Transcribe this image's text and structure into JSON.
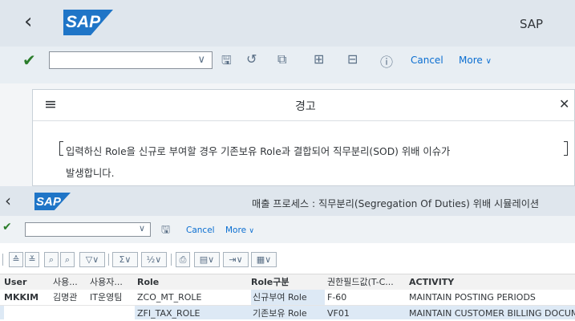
{
  "top_shell": {
    "title": "SAP",
    "logo_text": "SAP",
    "toolbar": {
      "cancel_label": "Cancel",
      "more_label": "More"
    }
  },
  "dialog": {
    "title": "경고",
    "message_line1": "입력하신 Role을 신규로 부여할 경우 기존보유 Role과 결합되어 직무분리(SOD) 위배 이슈가",
    "message_line2": "발생합니다."
  },
  "inner_shell": {
    "logo_text": "SAP",
    "title": "매출 프로세스 : 직무분리(Segregation Of Duties) 위배 시뮬레이션",
    "toolbar": {
      "cancel_label": "Cancel",
      "more_label": "More"
    }
  },
  "grid": {
    "columns": [
      "User",
      "사용...",
      "사용자...",
      "Role",
      "Role구분",
      "권한필드값(T-C...",
      "ACTIVITY"
    ],
    "rows": [
      [
        "MKKIM",
        "김명관",
        "IT운영팀",
        "ZCO_MT_ROLE",
        "신규부여 Role",
        "F-60",
        "MAINTAIN POSTING PERIODS"
      ],
      [
        "",
        "",
        "",
        "ZFI_TAX_ROLE",
        "기존보유 Role",
        "VF01",
        "MAINTAIN CUSTOMER BILLING DOCUMENT"
      ]
    ]
  },
  "icons": [
    "back-icon",
    "check-icon",
    "chevron-down-icon",
    "save-icon",
    "history-icon",
    "copy-icon",
    "expand-icon",
    "collapse-icon",
    "info-icon",
    "menu-icon",
    "close-icon",
    "sort-icon",
    "find-icon",
    "filter-icon",
    "sum-icon",
    "export-icon",
    "layout-icon"
  ],
  "colors": {
    "shell_bg": "#dfe6ed",
    "brand_blue": "#1f75c7",
    "check_green": "#2b7d2b",
    "link_blue": "#0a6ed1",
    "row_selected": "#dde9f5"
  }
}
